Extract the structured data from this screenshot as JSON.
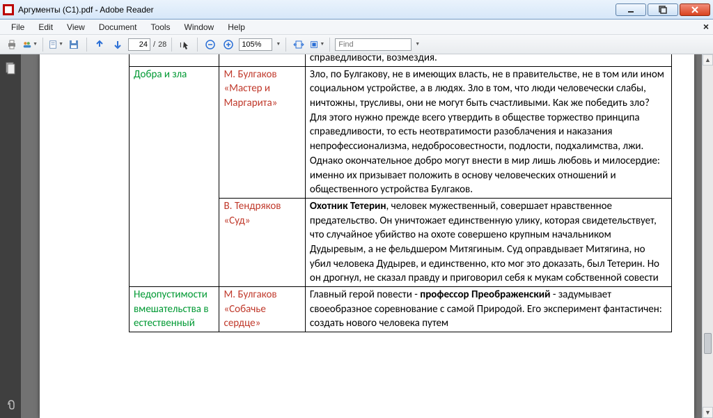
{
  "window": {
    "title": "Аргументы (С1).pdf - Adobe Reader"
  },
  "menu": {
    "items": [
      "File",
      "Edit",
      "View",
      "Document",
      "Tools",
      "Window",
      "Help"
    ]
  },
  "toolbar": {
    "page_current": "24",
    "page_sep": "/",
    "page_total": "28",
    "zoom": "105%",
    "find_placeholder": "Find"
  },
  "doc": {
    "top_fragment": "справедливости, возмездия.",
    "rows": [
      {
        "theme": "Добра и зла",
        "work": "М. Булгаков «Мастер и Маргарита»",
        "text": "Зло, по Булгакову, не в имеющих власть, не в правительстве, не в том или ином социальном устройстве, а в людях. Зло в том, что люди человечески слабы, ничтожны, трусливы, они не могут быть счастливыми. Как же победить зло? Для этого нужно прежде всего утвердить в обществе торжество принципа справедливости, то есть неотвратимости разоблачения и наказания непрофессионализма, недобросовестности, подлости, подхалимства, лжи. Однако окончательное добро могут внести в мир лишь любовь и милосердие: именно их призывает положить в основу человеческих отношений и общественного устройства Булгаков."
      },
      {
        "theme": "",
        "work": "В. Тендряков «Суд»",
        "bold": "Охотник Тетерин",
        "text": ", человек мужественный, совершает нравственное предательство. Он уничтожает единственную улику, которая свидетельствует, что случайное убийство на охоте совершено крупным начальником Дудыревым, а не фельдшером Митягиным. Суд оправдывает Митягина, но убил человека Дудырев, и единственно, кто мог это доказать, был Тетерин. Но он дрогнул, не сказал правду и приговорил себя к мукам собственной совести"
      },
      {
        "theme": "Недопустимости вмешательства в естественный",
        "work": "М. Булгаков «Собачье сердце»",
        "text_a": "Главный герой повести - ",
        "bold": "профессор Преображенский",
        "text_b": " - задумывает своеобразное соревнование с самой Природой. Его эксперимент фантастичен: создать нового человека путем"
      }
    ]
  }
}
